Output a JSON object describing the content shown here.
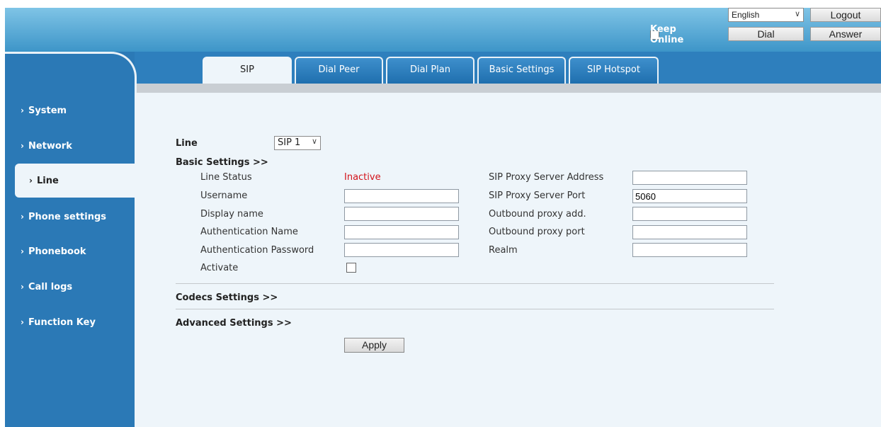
{
  "header": {
    "language": "English",
    "logout_label": "Logout",
    "keep_online_label": "Keep Online",
    "dial_label": "Dial",
    "answer_label": "Answer"
  },
  "tabs": [
    {
      "label": "SIP",
      "active": true
    },
    {
      "label": "Dial Peer",
      "active": false
    },
    {
      "label": "Dial Plan",
      "active": false
    },
    {
      "label": "Basic Settings",
      "active": false
    },
    {
      "label": "SIP Hotspot",
      "active": false
    }
  ],
  "sidebar": {
    "items": [
      {
        "label": "System"
      },
      {
        "label": "Network"
      },
      {
        "label": "Line",
        "active": true
      },
      {
        "label": "Phone settings"
      },
      {
        "label": "Phonebook"
      },
      {
        "label": "Call logs"
      },
      {
        "label": "Function Key"
      }
    ]
  },
  "form": {
    "line_label": "Line",
    "line_value": "SIP 1",
    "basic_settings_header": "Basic Settings >>",
    "line_status_label": "Line Status",
    "line_status_value": "Inactive",
    "username_label": "Username",
    "username_value": "",
    "display_name_label": "Display name",
    "display_name_value": "",
    "auth_name_label": "Authentication Name",
    "auth_name_value": "",
    "auth_password_label": "Authentication Password",
    "auth_password_value": "",
    "activate_label": "Activate",
    "proxy_address_label": "SIP Proxy Server Address",
    "proxy_address_value": "",
    "proxy_port_label": "SIP Proxy Server Port",
    "proxy_port_value": "5060",
    "outbound_add_label": "Outbound proxy add.",
    "outbound_add_value": "",
    "outbound_port_label": "Outbound proxy port",
    "outbound_port_value": "",
    "realm_label": "Realm",
    "realm_value": "",
    "codecs_header": "Codecs Settings >>",
    "advanced_header": "Advanced Settings >>",
    "apply_label": "Apply"
  },
  "colors": {
    "banner_top": "#7fc4e6",
    "banner_bottom": "#3d95c8",
    "sidebar": "#2b79b6",
    "content_bg": "#eef5fa",
    "status_inactive": "#d3121a"
  }
}
